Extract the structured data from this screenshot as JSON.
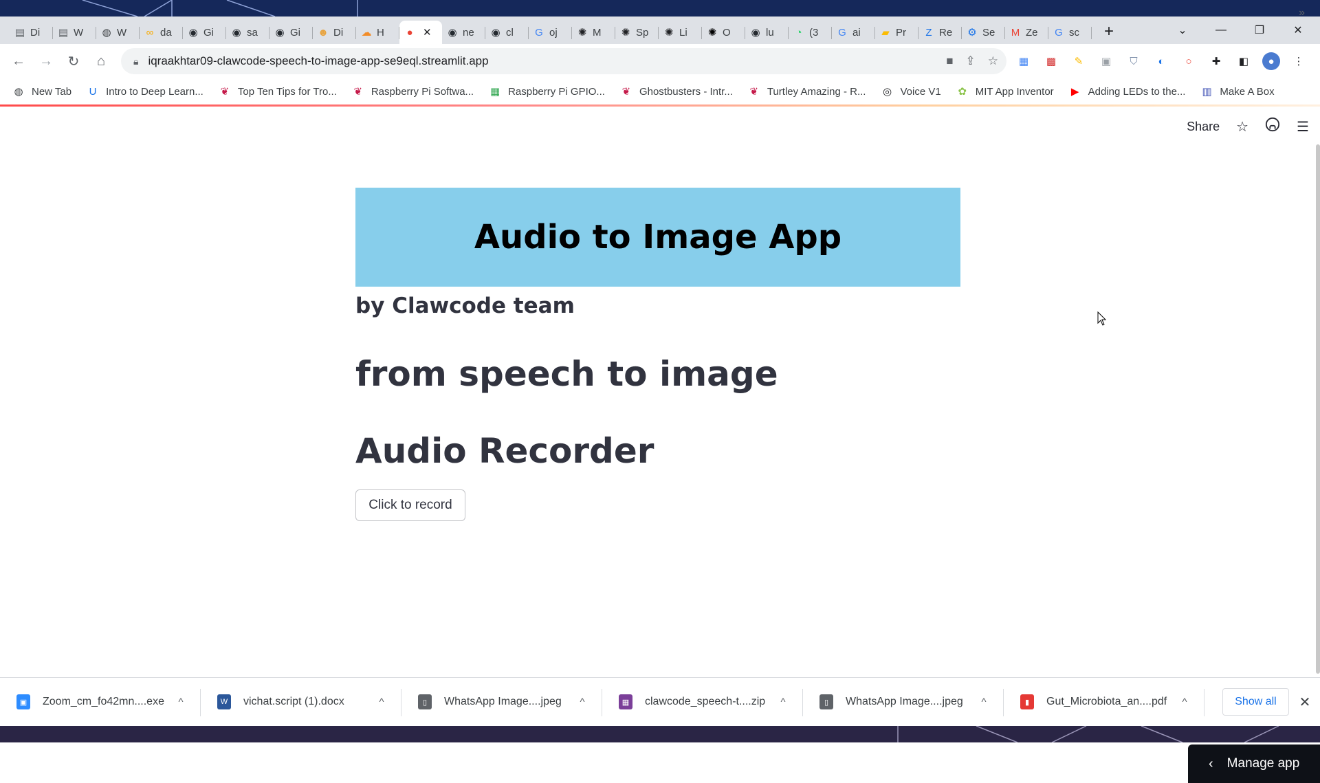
{
  "browser": {
    "tabs": [
      {
        "label": "Di",
        "icon": "page-icon",
        "color": "#5f6368"
      },
      {
        "label": "W",
        "icon": "page-icon",
        "color": "#5f6368"
      },
      {
        "label": "W",
        "icon": "globe-icon",
        "color": "#3c4043"
      },
      {
        "label": "da",
        "icon": "colab-icon",
        "color": "#f9ab00"
      },
      {
        "label": "Gi",
        "icon": "github-icon",
        "color": "#24292f"
      },
      {
        "label": "sa",
        "icon": "github-icon",
        "color": "#24292f"
      },
      {
        "label": "Gi",
        "icon": "github-icon",
        "color": "#24292f"
      },
      {
        "label": "Di",
        "icon": "person-icon",
        "color": "#e8a33d"
      },
      {
        "label": "H",
        "icon": "cloud-icon",
        "color": "#f28c28"
      },
      {
        "label": "",
        "icon": "record-icon",
        "color": "#ea4335",
        "active": true
      },
      {
        "label": "ne",
        "icon": "github-icon",
        "color": "#24292f"
      },
      {
        "label": "cl",
        "icon": "github-icon",
        "color": "#24292f"
      },
      {
        "label": "oj",
        "icon": "google-icon",
        "color": "#4285f4"
      },
      {
        "label": "M",
        "icon": "openai-icon",
        "color": "#202124"
      },
      {
        "label": "Sp",
        "icon": "openai-icon",
        "color": "#202124"
      },
      {
        "label": "Li",
        "icon": "openai-icon",
        "color": "#202124"
      },
      {
        "label": "O",
        "icon": "openai-icon",
        "color": "#000000"
      },
      {
        "label": "lu",
        "icon": "github-icon",
        "color": "#24292f"
      },
      {
        "label": "(3",
        "icon": "whatsapp-icon",
        "color": "#25d366"
      },
      {
        "label": "ai",
        "icon": "google-icon",
        "color": "#4285f4"
      },
      {
        "label": "Pr",
        "icon": "slides-icon",
        "color": "#fbbc04"
      },
      {
        "label": "Re",
        "icon": "zotero-icon",
        "color": "#1a73e8"
      },
      {
        "label": "Se",
        "icon": "settings-icon",
        "color": "#1a73e8"
      },
      {
        "label": "Ze",
        "icon": "gmail-icon",
        "color": "#ea4335"
      },
      {
        "label": "sc",
        "icon": "google-icon",
        "color": "#4285f4"
      }
    ],
    "new_tab": "+",
    "window_controls": {
      "dropdown": "⌄",
      "minimize": "—",
      "restore": "❐",
      "close": "✕"
    },
    "url": "iqraakhtar09-clawcode-speech-to-image-app-se9eql.streamlit.app",
    "bookmarks": [
      {
        "label": "New Tab",
        "icon": "globe-icon",
        "color": "#3c4043"
      },
      {
        "label": "Intro to Deep Learn...",
        "icon": "u-icon",
        "color": "#1a73e8"
      },
      {
        "label": "Top Ten Tips for Tro...",
        "icon": "raspberry-icon",
        "color": "#c51a4a"
      },
      {
        "label": "Raspberry Pi Softwa...",
        "icon": "raspberry-icon",
        "color": "#c51a4a"
      },
      {
        "label": "Raspberry Pi GPIO...",
        "icon": "grid-icon",
        "color": "#34a853"
      },
      {
        "label": "Ghostbusters - Intr...",
        "icon": "raspberry-icon",
        "color": "#c51a4a"
      },
      {
        "label": "Turtley Amazing - R...",
        "icon": "raspberry-icon",
        "color": "#c51a4a"
      },
      {
        "label": "Voice V1",
        "icon": "voice-icon",
        "color": "#202124"
      },
      {
        "label": "MIT App Inventor",
        "icon": "appinventor-icon",
        "color": "#8bc34a"
      },
      {
        "label": "Adding LEDs to the...",
        "icon": "youtube-icon",
        "color": "#ff0000"
      },
      {
        "label": "Make A Box",
        "icon": "box-icon",
        "color": "#3f51b5"
      }
    ],
    "bookmarks_more": "»"
  },
  "app": {
    "header": {
      "share_label": "Share"
    },
    "banner_title": "Audio to Image App",
    "byline": "by Clawcode team",
    "subheading": "from speech to image",
    "recorder_title": "Audio Recorder",
    "record_button": "Click to record",
    "manage_app": "Manage app"
  },
  "downloads": {
    "items": [
      {
        "name": "Zoom_cm_fo42mn....exe",
        "icon": "zoom-icon",
        "color": "#2d8cff"
      },
      {
        "name": "vichat.script (1).docx",
        "icon": "word-icon",
        "color": "#2b579a"
      },
      {
        "name": "WhatsApp Image....jpeg",
        "icon": "image-file-icon",
        "color": "#5f6368"
      },
      {
        "name": "clawcode_speech-t....zip",
        "icon": "zip-icon",
        "color": "#7b3f99"
      },
      {
        "name": "WhatsApp Image....jpeg",
        "icon": "image-file-icon",
        "color": "#5f6368"
      },
      {
        "name": "Gut_Microbiota_an....pdf",
        "icon": "pdf-icon",
        "color": "#e53935"
      }
    ],
    "show_all": "Show all",
    "close": "✕"
  },
  "colors": {
    "banner_bg": "#87ceeb",
    "text_primary": "#31333f",
    "manage_app_bg": "#0e1117",
    "accent": "#ff4b4b"
  }
}
